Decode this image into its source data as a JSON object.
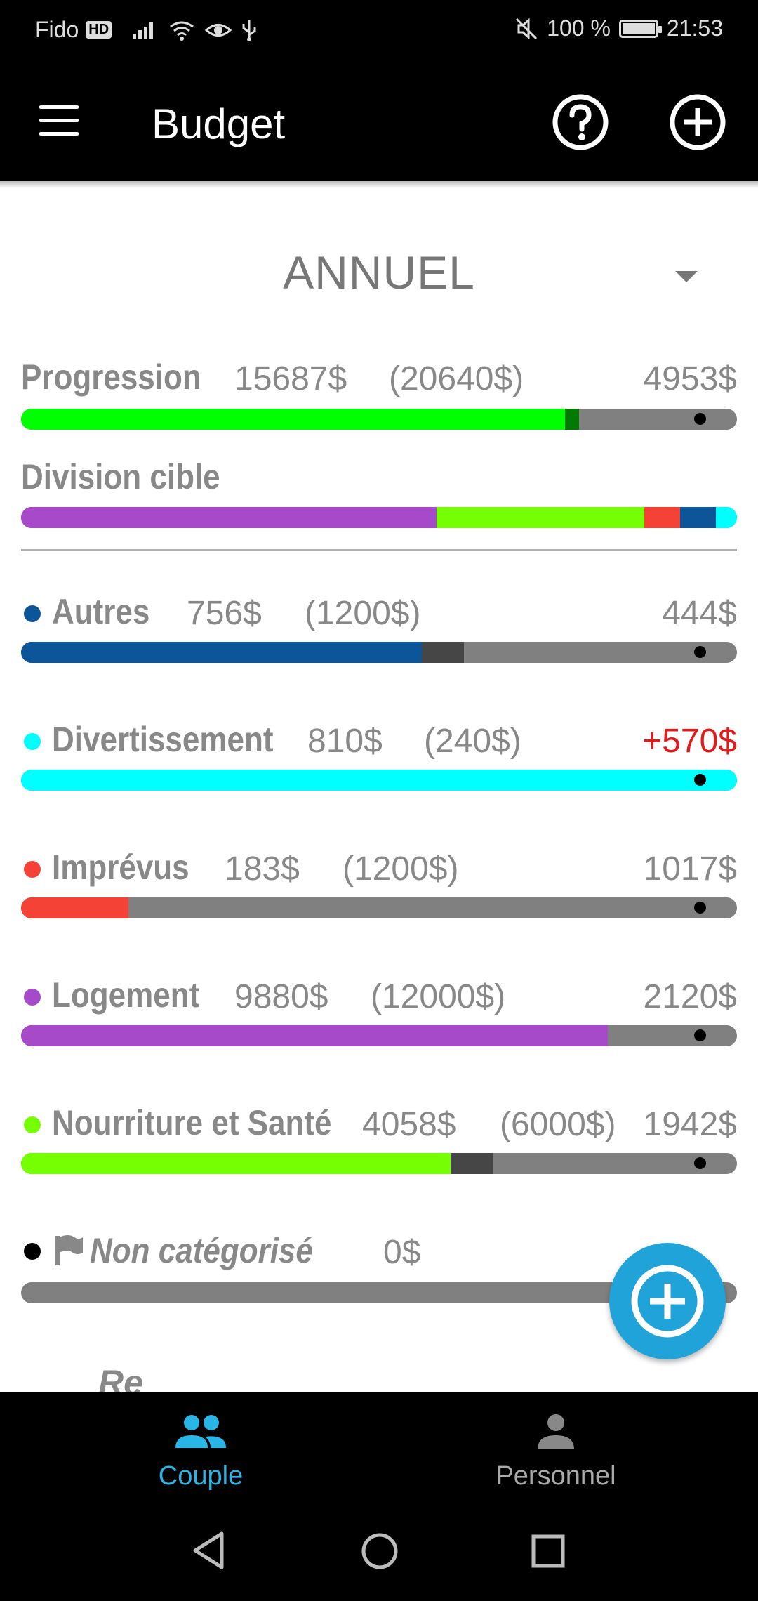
{
  "status_bar": {
    "carrier": "Fido",
    "hd": "HD",
    "battery": "100 %",
    "time": "21:53"
  },
  "app_bar": {
    "title": "Budget"
  },
  "period": {
    "selected": "ANNUEL"
  },
  "progression": {
    "label": "Progression",
    "spent": "15687$",
    "budget": "(20640$)",
    "remaining": "4953$",
    "fill_fraction": 0.76,
    "marker_fraction": 0.94,
    "color": "#00ff00"
  },
  "division": {
    "label": "Division cible",
    "segments": [
      {
        "name": "Logement",
        "color": "#a64ac9",
        "fraction": 0.58
      },
      {
        "name": "Nourriture et Santé",
        "color": "#76ff03",
        "fraction": 0.29
      },
      {
        "name": "Imprévus",
        "color": "#f44336",
        "fraction": 0.05
      },
      {
        "name": "Autres",
        "color": "#0d5599",
        "fraction": 0.05
      },
      {
        "name": "Divertissement",
        "color": "#00ffff",
        "fraction": 0.03
      }
    ]
  },
  "categories": [
    {
      "name": "Autres",
      "spent": "756$",
      "budget": "(1200$)",
      "remaining": "444$",
      "color": "#0d5599",
      "fill_fraction": 0.56,
      "over": false
    },
    {
      "name": "Divertissement",
      "spent": "810$",
      "budget": "(240$)",
      "remaining": "+570$",
      "color": "#00ffff",
      "fill_fraction": 1.0,
      "over": true
    },
    {
      "name": "Imprévus",
      "spent": "183$",
      "budget": "(1200$)",
      "remaining": "1017$",
      "color": "#f44336",
      "fill_fraction": 0.15,
      "over": false
    },
    {
      "name": "Logement",
      "spent": "9880$",
      "budget": "(12000$)",
      "remaining": "2120$",
      "color": "#a64ac9",
      "fill_fraction": 0.82,
      "over": false
    },
    {
      "name": "Nourriture et Santé",
      "spent": "4058$",
      "budget": "(6000$)",
      "remaining": "1942$",
      "color": "#76ff03",
      "fill_fraction": 0.6,
      "over": false
    }
  ],
  "uncategorized": {
    "name": "Non catégorisé",
    "spent": "0$"
  },
  "bottom_nav": {
    "couple": "Couple",
    "personnel": "Personnel",
    "active_color": "#29b6e6"
  }
}
